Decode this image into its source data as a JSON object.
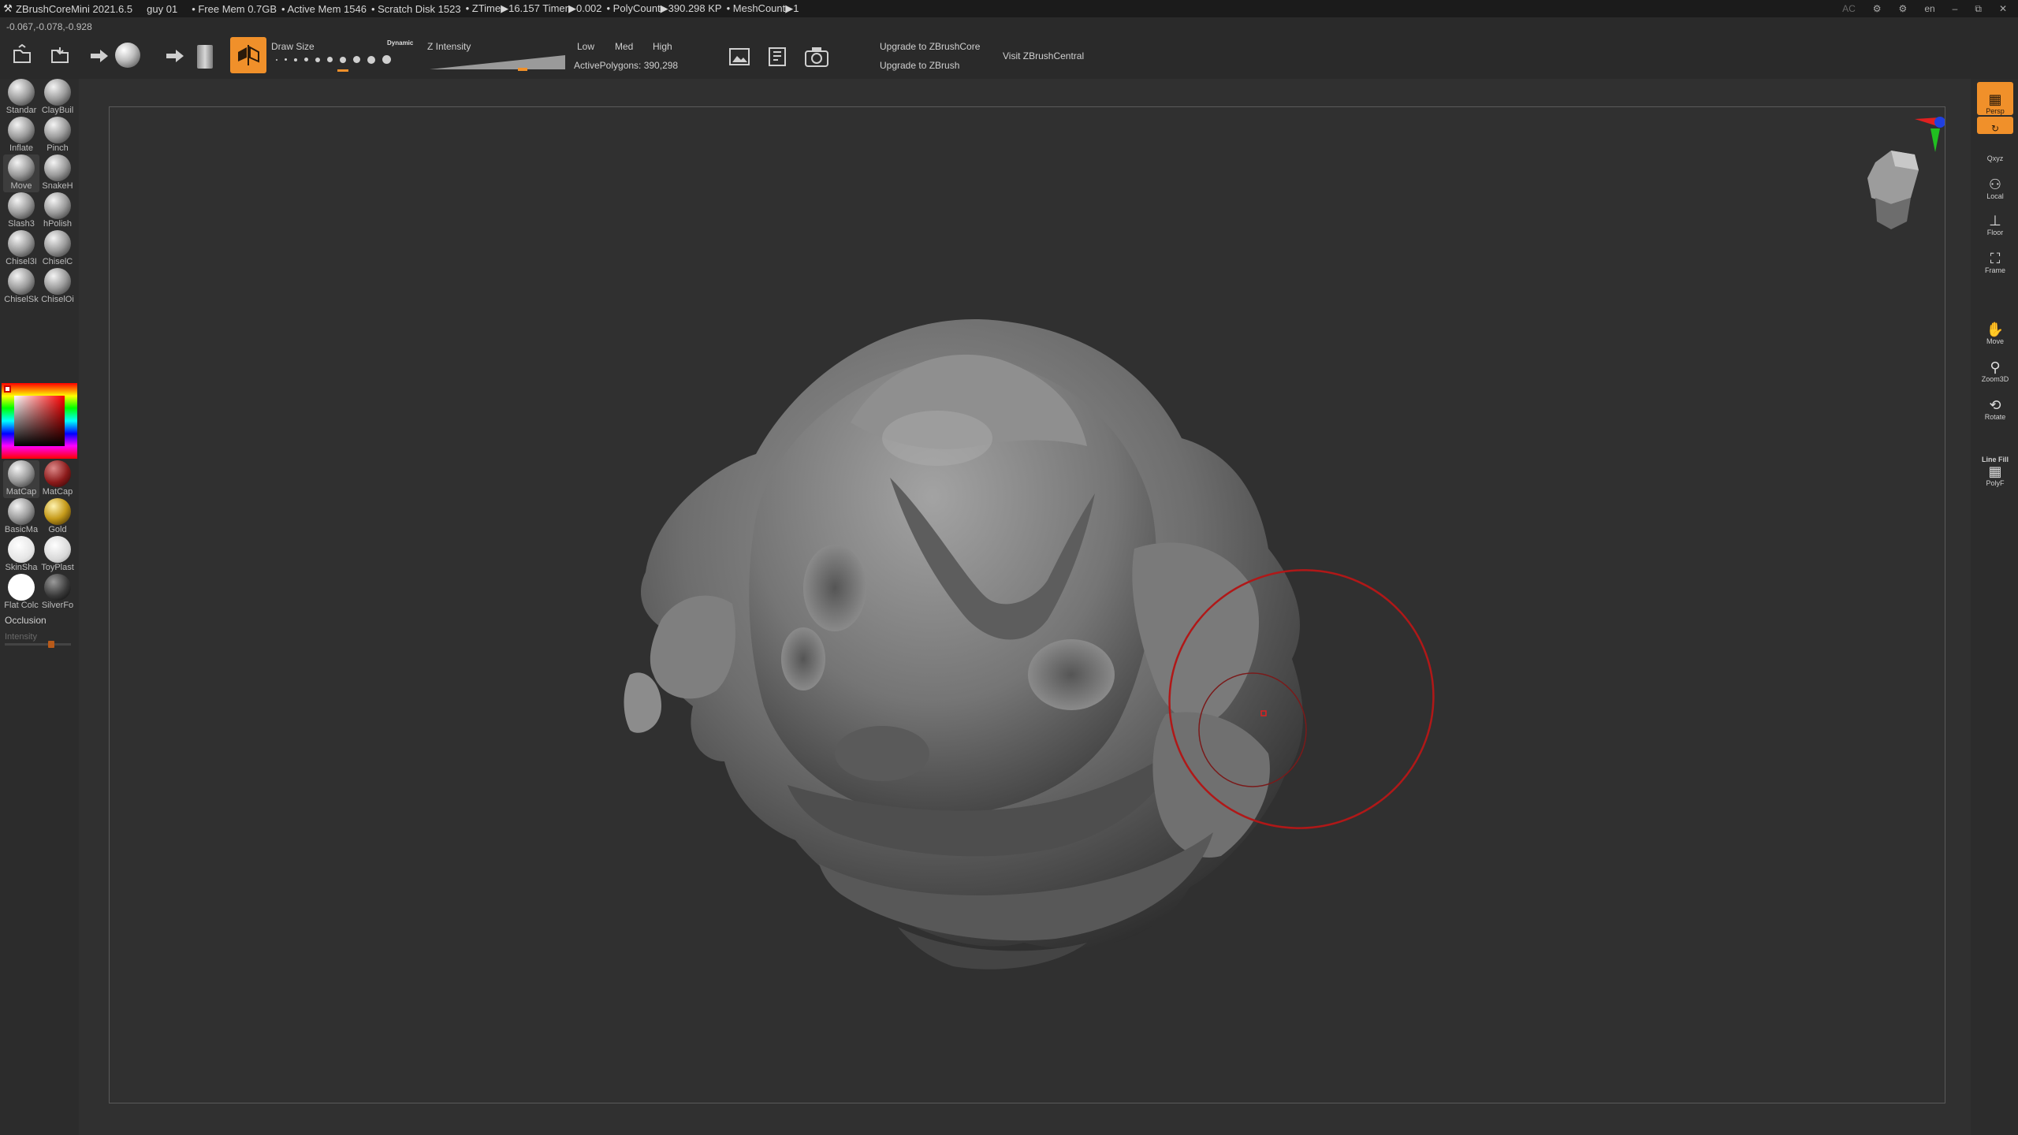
{
  "titlebar": {
    "app_title": "ZBrushCoreMini 2021.6.5",
    "project": "guy 01",
    "free_mem": "• Free Mem 0.7GB",
    "active_mem": "• Active Mem 1546",
    "scratch": "• Scratch Disk 1523",
    "ztime": "• ZTime▶16.157 Timer▶0.002",
    "polycount": "• PolyCount▶390.298 KP",
    "meshcount": "• MeshCount▶1",
    "right_ac": "AC",
    "lang": "en",
    "minimize": "–",
    "restore": "⧉",
    "close": "✕"
  },
  "coords": "-0.067,-0.078,-0.928",
  "toolbar": {
    "draw_size_label": "Draw Size",
    "dynamic_label": "Dynamic",
    "z_intensity_label": "Z Intensity",
    "low": "Low",
    "med": "Med",
    "high": "High",
    "active_polygons": "ActivePolygons: 390,298",
    "upgrade_core": "Upgrade to ZBrushCore",
    "upgrade_zbrush": "Upgrade to ZBrush",
    "visit_central": "Visit ZBrushCentral"
  },
  "left": {
    "brushes": [
      {
        "label": "Standar"
      },
      {
        "label": "ClayBuil"
      },
      {
        "label": "Inflate"
      },
      {
        "label": "Pinch"
      },
      {
        "label": "Move"
      },
      {
        "label": "SnakeH"
      },
      {
        "label": "Slash3"
      },
      {
        "label": "hPolish"
      },
      {
        "label": "Chisel3I"
      },
      {
        "label": "ChiselC"
      },
      {
        "label": "ChiselSk"
      },
      {
        "label": "ChiselOi"
      }
    ],
    "materials": [
      {
        "label": "MatCap"
      },
      {
        "label": "MatCap"
      },
      {
        "label": "BasicMa"
      },
      {
        "label": "Gold"
      },
      {
        "label": "SkinSha"
      },
      {
        "label": "ToyPlast"
      },
      {
        "label": "Flat Colc"
      },
      {
        "label": "SilverFo"
      }
    ],
    "occlusion": "Occlusion",
    "intensity": "Intensity",
    "intensity_value": 0.7
  },
  "right": {
    "persp": "Persp",
    "xyz": "Qxyz",
    "local": "Local",
    "floor": "Floor",
    "frame": "Frame",
    "move": "Move",
    "zoom": "Zoom3D",
    "rotate": "Rotate",
    "linefill": "Line Fill",
    "polyf": "PolyF"
  },
  "colors": {
    "accent": "#f0902a",
    "brush_ring": "#b01818",
    "background": "#303030"
  }
}
